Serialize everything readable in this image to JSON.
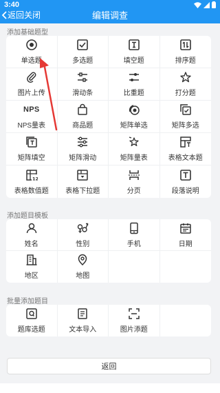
{
  "status": {
    "time": "3:40"
  },
  "header": {
    "back_label": "返回",
    "close_label": "关闭",
    "title": "编辑调查"
  },
  "sections": {
    "basic": {
      "title": "添加基础题型",
      "items": [
        {
          "label": "单选题",
          "icon": "radio-icon"
        },
        {
          "label": "多选题",
          "icon": "checkbox-icon"
        },
        {
          "label": "填空题",
          "icon": "text-field-icon"
        },
        {
          "label": "排序题",
          "icon": "sort-icon"
        },
        {
          "label": "图片上传",
          "icon": "paperclip-icon"
        },
        {
          "label": "滑动条",
          "icon": "slider-icon"
        },
        {
          "label": "比重题",
          "icon": "weight-slider-icon"
        },
        {
          "label": "打分题",
          "icon": "star-icon"
        },
        {
          "label": "NPS量表",
          "icon": "nps-icon",
          "icon_text": "NPS"
        },
        {
          "label": "商品题",
          "icon": "shopping-bag-icon"
        },
        {
          "label": "矩阵单选",
          "icon": "matrix-radio-icon"
        },
        {
          "label": "矩阵多选",
          "icon": "matrix-checkbox-icon"
        },
        {
          "label": "矩阵填空",
          "icon": "matrix-fill-icon"
        },
        {
          "label": "矩阵滑动",
          "icon": "matrix-slider-icon"
        },
        {
          "label": "矩阵量表",
          "icon": "matrix-scale-icon"
        },
        {
          "label": "表格文本题",
          "icon": "table-text-icon"
        },
        {
          "label": "表格数值题",
          "icon": "table-number-icon"
        },
        {
          "label": "表格下拉题",
          "icon": "table-dropdown-icon"
        },
        {
          "label": "分页",
          "icon": "page-break-icon"
        },
        {
          "label": "段落说明",
          "icon": "paragraph-icon"
        }
      ]
    },
    "template": {
      "title": "添加题目模板",
      "items": [
        {
          "label": "姓名",
          "icon": "person-icon"
        },
        {
          "label": "性别",
          "icon": "gender-icon"
        },
        {
          "label": "手机",
          "icon": "phone-icon"
        },
        {
          "label": "日期",
          "icon": "calendar-icon"
        },
        {
          "label": "地区",
          "icon": "building-icon"
        },
        {
          "label": "地图",
          "icon": "map-pin-icon"
        }
      ]
    },
    "batch": {
      "title": "批量添加题目",
      "items": [
        {
          "label": "题库选题",
          "icon": "question-bank-icon",
          "icon_text": "Q"
        },
        {
          "label": "文本导入",
          "icon": "document-icon"
        },
        {
          "label": "图片添题",
          "icon": "scan-icon"
        }
      ]
    }
  },
  "footer": {
    "return_label": "返回"
  },
  "colors": {
    "header": "#2196f3",
    "arrow": "#e53935"
  }
}
